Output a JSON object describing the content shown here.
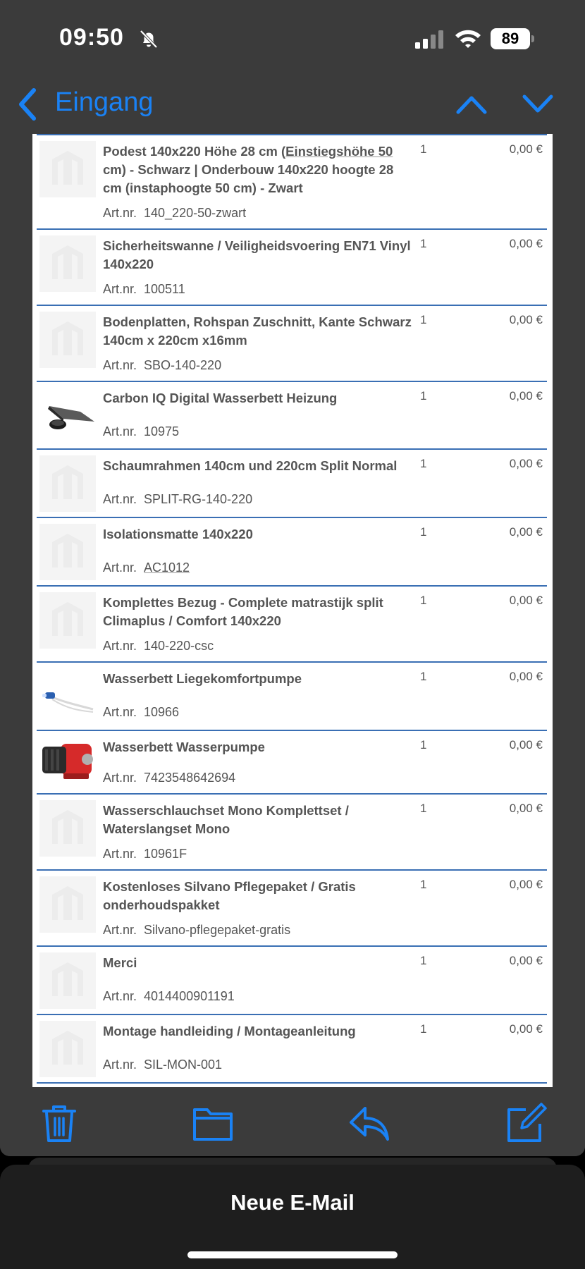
{
  "status_bar": {
    "time": "09:50",
    "battery_level": "89"
  },
  "nav": {
    "back_label": "Eingang"
  },
  "order_items": [
    {
      "name_parts": [
        "Podest 140x220 Höhe 28 cm (",
        "Einstiegshöhe 50",
        " cm) - Schwarz | Onderbouw 140x220 hoogte 28 cm (instaphoogte 50 cm) - Zwart"
      ],
      "sku_label": "Art.nr.",
      "sku": "140_220-50-zwart",
      "qty": "1",
      "price": "0,00 €",
      "thumb": "placeholder-logo-icon"
    },
    {
      "name": "Sicherheitswanne / Veiligheidsvoering EN71 Vinyl 140x220",
      "sku_label": "Art.nr.",
      "sku": "100511",
      "qty": "1",
      "price": "0,00 €",
      "thumb": "placeholder-logo-icon"
    },
    {
      "name": "Bodenplatten, Rohspan Zuschnitt, Kante Schwarz 140cm x 220cm x16mm",
      "sku_label": "Art.nr.",
      "sku": "SBO-140-220",
      "qty": "1",
      "price": "0,00 €",
      "thumb": "placeholder-logo-icon"
    },
    {
      "name": "Carbon IQ Digital Wasserbett Heizung",
      "sku_label": "Art.nr.",
      "sku": "10975",
      "qty": "1",
      "price": "0,00 €",
      "thumb": "heater-product-icon"
    },
    {
      "name": "Schaumrahmen 140cm und 220cm Split Normal",
      "sku_label": "Art.nr.",
      "sku": "SPLIT-RG-140-220",
      "qty": "1",
      "price": "0,00 €",
      "thumb": "placeholder-logo-icon"
    },
    {
      "name": "Isolationsmatte 140x220",
      "sku_label": "Art.nr.",
      "sku": "AC1012",
      "qty": "1",
      "price": "0,00 €",
      "thumb": "placeholder-logo-icon"
    },
    {
      "name": "Komplettes Bezug - Complete matrastijk split Climaplus / Comfort 140x220",
      "sku_label": "Art.nr.",
      "sku": "140-220-csc",
      "qty": "1",
      "price": "0,00 €",
      "thumb": "placeholder-logo-icon"
    },
    {
      "name": "Wasserbett Liegekomfortpumpe",
      "sku_label": "Art.nr.",
      "sku": "10966",
      "qty": "1",
      "price": "0,00 €",
      "thumb": "hand-pump-product-icon"
    },
    {
      "name": "Wasserbett Wasserpumpe",
      "sku_label": "Art.nr.",
      "sku": "7423548642694",
      "qty": "1",
      "price": "0,00 €",
      "thumb": "water-pump-product-icon"
    },
    {
      "name": "Wasserschlauchset Mono Komplettset / Waterslangset Mono",
      "sku_label": "Art.nr.",
      "sku": "10961F",
      "qty": "1",
      "price": "0,00 €",
      "thumb": "placeholder-logo-icon"
    },
    {
      "name": "Kostenloses Silvano Pflegepaket / Gratis onderhoudspakket",
      "sku_label": "Art.nr.",
      "sku": "Silvano-pflegepaket-gratis",
      "qty": "1",
      "price": "0,00 €",
      "thumb": "placeholder-logo-icon"
    },
    {
      "name": "Merci",
      "sku_label": "Art.nr.",
      "sku": "4014400901191",
      "qty": "1",
      "price": "0,00 €",
      "thumb": "placeholder-logo-icon"
    },
    {
      "name": "Montage handleiding / Montageanleitung",
      "sku_label": "Art.nr.",
      "sku": "SIL-MON-001",
      "qty": "1",
      "price": "0,00 €",
      "thumb": "placeholder-logo-icon"
    }
  ],
  "toolbar": {
    "icons": [
      "trash-icon",
      "folder-icon",
      "reply-icon",
      "compose-icon"
    ]
  },
  "compose_sheet": {
    "title": "Neue E-Mail"
  },
  "colors": {
    "accent": "#1a82f5",
    "divider": "#3a6fb4",
    "chrome": "#3b3b3b"
  }
}
